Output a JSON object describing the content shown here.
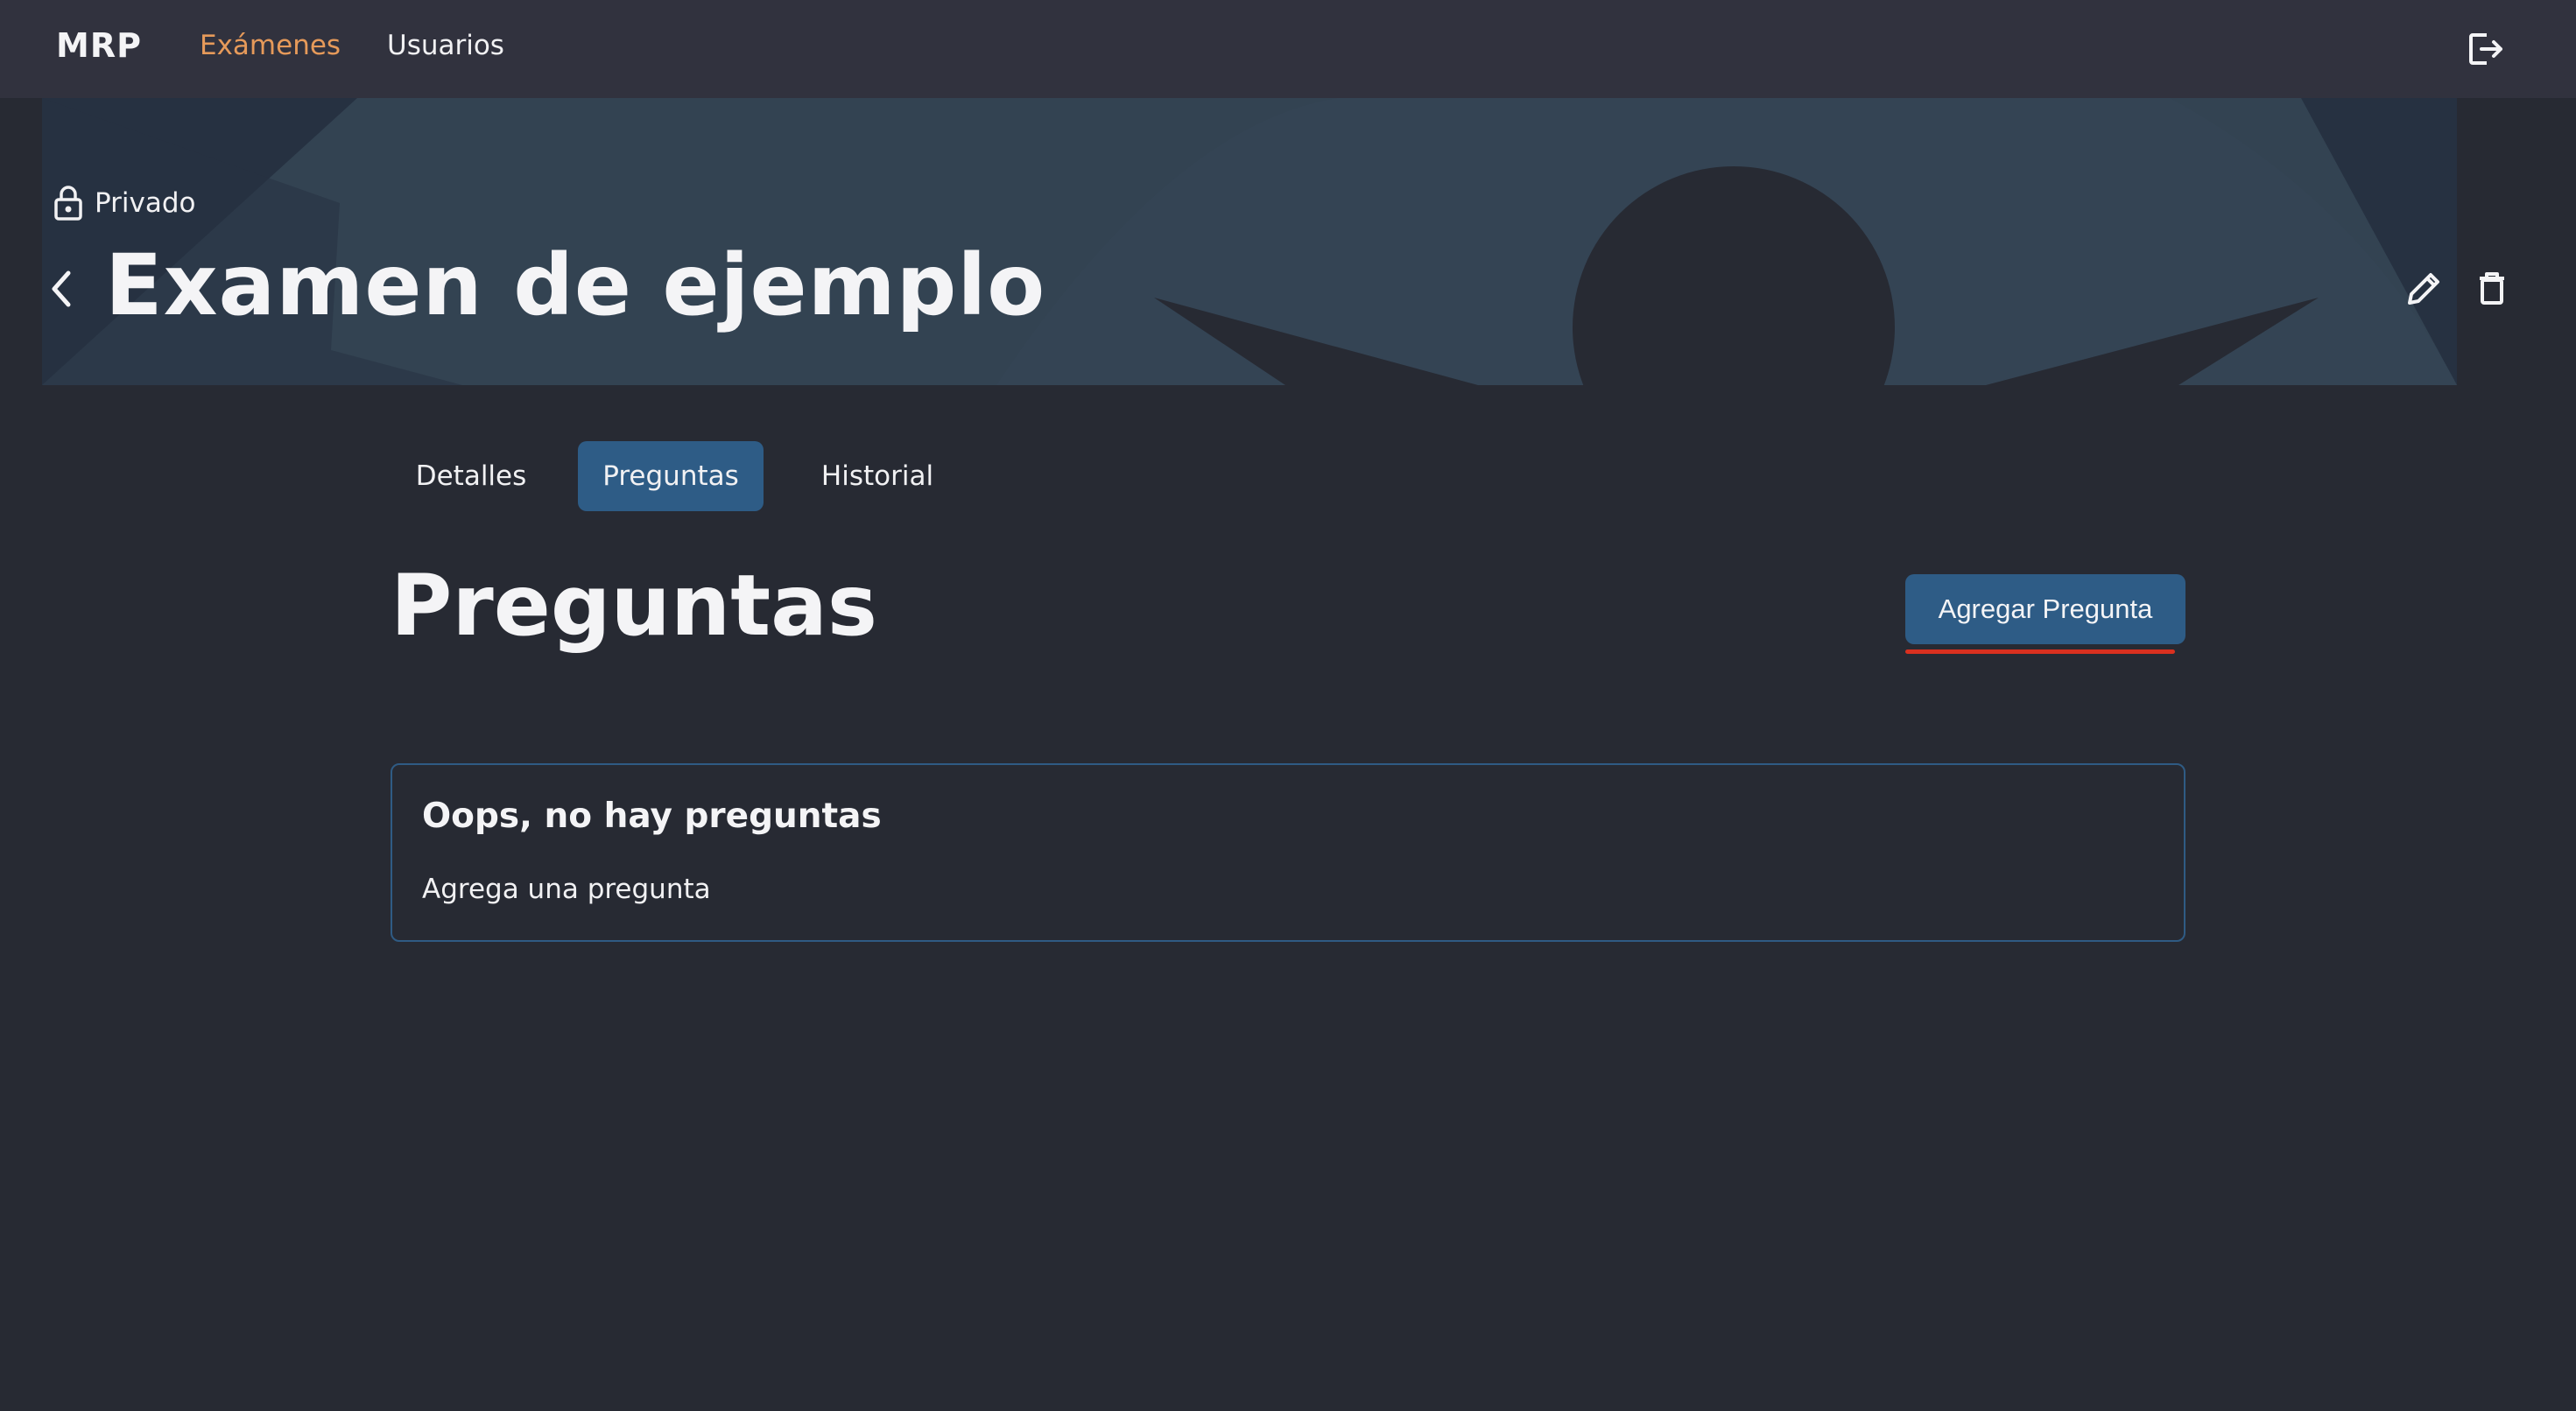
{
  "nav": {
    "brand": "MRP",
    "links": [
      {
        "label": "Exámenes",
        "active": true
      },
      {
        "label": "Usuarios",
        "active": false
      }
    ],
    "logout_icon": "logout-icon"
  },
  "hero": {
    "privacy_label": "Privado",
    "privacy_icon": "lock-icon",
    "title": "Examen de ejemplo",
    "back_icon": "chevron-left-icon",
    "actions": [
      "pencil-icon",
      "trash-icon"
    ]
  },
  "tabs": [
    {
      "label": "Detalles",
      "active": false
    },
    {
      "label": "Preguntas",
      "active": true
    },
    {
      "label": "Historial",
      "active": false
    }
  ],
  "section": {
    "title": "Preguntas",
    "add_button": "Agregar Pregunta"
  },
  "empty_state": {
    "title": "Oops, no hay preguntas",
    "body": "Agrega una pregunta"
  },
  "colors": {
    "background": "#272a33",
    "topbar": "#31323e",
    "accent": "#2e5c86",
    "active_nav": "#e69a5a",
    "highlight": "#d9301f"
  }
}
